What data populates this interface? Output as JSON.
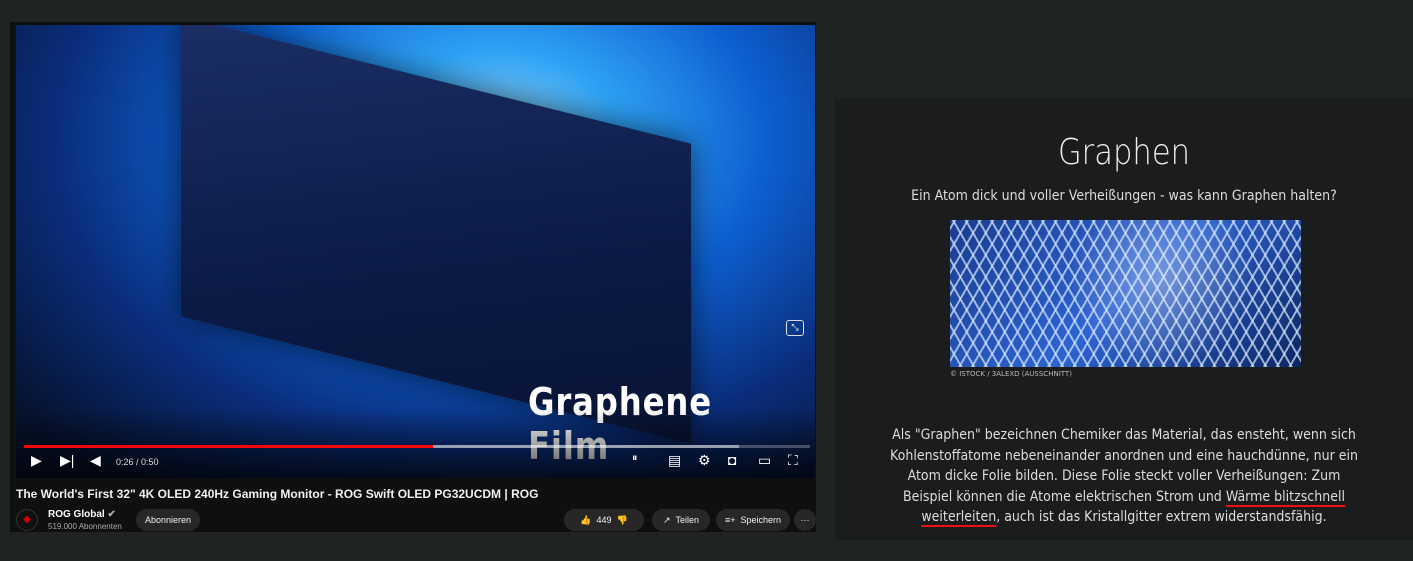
{
  "video": {
    "overlay_text": "Graphene Film",
    "time": "0:26 / 0:50",
    "progress_fraction": 0.52,
    "title": "The World's First 32\" 4K OLED 240Hz Gaming Monitor - ROG Swift OLED PG32UCDM | ROG",
    "channel": "ROG Global",
    "subscribers": "519.000 Abonnenten",
    "subscribe_label": "Abonnieren",
    "likes": "449",
    "share_label": "Teilen",
    "save_label": "Speichern",
    "more_label": "···",
    "quality_badge": "4K"
  },
  "article": {
    "title": "Graphen",
    "subtitle": "Ein Atom dick und voller Verheißungen - was kann Graphen halten?",
    "image_credit": "© ISTOCK / 3ALEXD (AUSSCHNITT)",
    "body_pre": "Als \"Graphen\" bezeichnen Chemiker das Material, das ensteht, wenn sich Kohlenstoffatome nebeneinander anordnen und eine hauchdünne, nur ein Atom dicke Folie bilden. Diese Folie steckt voller Verheißungen: Zum Beispiel können die Atome elektrischen Strom und ",
    "body_highlight": "Wärme blitzschnell weiterleiten",
    "body_post": ", auch ist das Kristallgitter extrem widerstandsfähig."
  },
  "colors": {
    "accent": "#ff0000",
    "underline": "#e11111"
  }
}
